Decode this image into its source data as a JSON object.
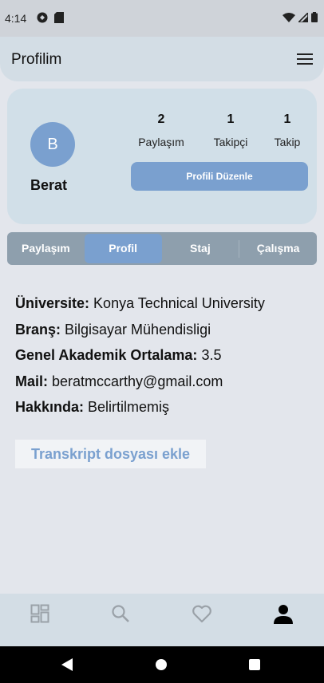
{
  "status_bar": {
    "time": "4:14",
    "left_icons": [
      "sync-icon",
      "sim-card-icon"
    ],
    "right_icons": [
      "wifi-icon",
      "signal-icon",
      "battery-icon"
    ]
  },
  "app_bar": {
    "title": "Profilim",
    "menu_icon": "hamburger-menu-icon"
  },
  "profile": {
    "avatar_letter": "B",
    "name": "Berat",
    "stats": [
      {
        "value": "2",
        "label": "Paylaşım"
      },
      {
        "value": "1",
        "label": "Takipçi"
      },
      {
        "value": "1",
        "label": "Takip"
      }
    ],
    "edit_button": "Profili Düzenle"
  },
  "tabs": [
    {
      "label": "Paylaşım",
      "active": false
    },
    {
      "label": "Profil",
      "active": true
    },
    {
      "label": "Staj",
      "active": false
    },
    {
      "label": "Çalışma",
      "active": false
    }
  ],
  "info": [
    {
      "key": "Üniversite:",
      "value": " Konya Technical University"
    },
    {
      "key": "Branş:",
      "value": " Bilgisayar Mühendisligi"
    },
    {
      "key": "Genel Akademik Ortalama:",
      "value": " 3.5"
    },
    {
      "key": "Mail:",
      "value": " beratmccarthy@gmail.com"
    },
    {
      "key": "Hakkında:",
      "value": " Belirtilmemiş"
    }
  ],
  "transcript_button": "Transkript dosyası ekle",
  "bottom_nav": {
    "items": [
      "dashboard-icon",
      "search-icon",
      "heart-icon",
      "person-icon"
    ],
    "active": "person-icon"
  },
  "colors": {
    "accent": "#7aa0cf",
    "card_bg": "#d1dfe8",
    "page_bg": "#e3e6ec",
    "tab_bg": "#8e9fad"
  }
}
